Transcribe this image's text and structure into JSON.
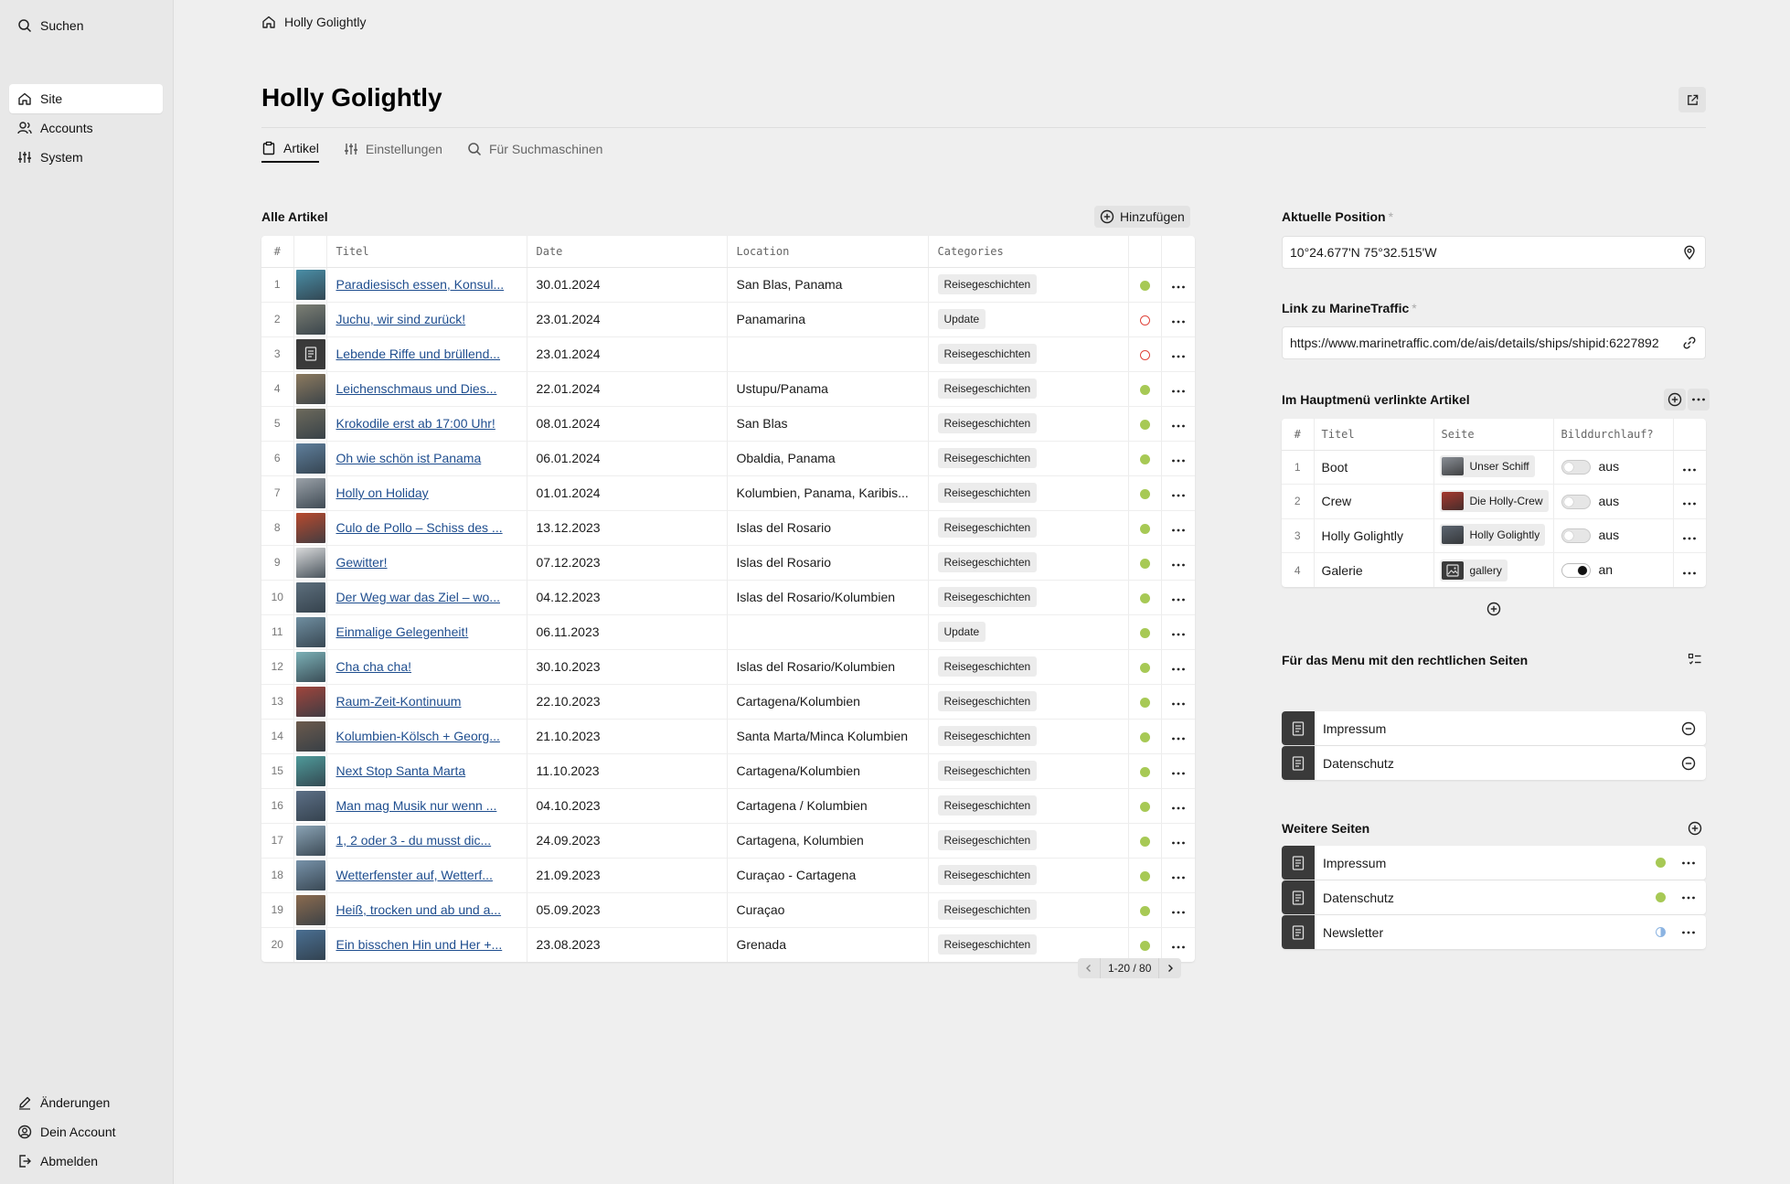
{
  "sidebar": {
    "search_label": "Suchen",
    "nav": [
      {
        "label": "Site",
        "active": true,
        "icon": "home-icon"
      },
      {
        "label": "Accounts",
        "active": false,
        "icon": "users-icon"
      },
      {
        "label": "System",
        "active": false,
        "icon": "sliders-icon"
      }
    ],
    "bottom": [
      {
        "label": "Änderungen",
        "icon": "pencil-icon"
      },
      {
        "label": "Dein Account",
        "icon": "account-icon"
      },
      {
        "label": "Abmelden",
        "icon": "logout-icon"
      }
    ]
  },
  "header": {
    "breadcrumb": "Holly Golightly",
    "title": "Holly Golightly",
    "tabs": [
      {
        "label": "Artikel",
        "active": true,
        "icon": "clipboard-icon"
      },
      {
        "label": "Einstellungen",
        "active": false,
        "icon": "sliders-icon"
      },
      {
        "label": "Für Suchmaschinen",
        "active": false,
        "icon": "search-icon"
      }
    ]
  },
  "articles": {
    "heading": "Alle Artikel",
    "add_label": "Hinzufügen",
    "columns": [
      "#",
      "",
      "Titel",
      "Date",
      "Location",
      "Categories"
    ],
    "rows": [
      {
        "n": "1",
        "title": "Paradiesisch essen, Konsul...",
        "date": "30.01.2024",
        "location": "San Blas, Panama",
        "category": "Reisegeschichten",
        "status": "listed",
        "thumb": "#4a8ea6"
      },
      {
        "n": "2",
        "title": "Juchu, wir sind zurück!",
        "date": "23.01.2024",
        "location": "Panamarina",
        "category": "Update",
        "status": "draft",
        "thumb": "#7c7f74"
      },
      {
        "n": "3",
        "title": "Lebende Riffe und brüllend...",
        "date": "23.01.2024",
        "location": "",
        "category": "Reisegeschichten",
        "status": "draft",
        "thumb": "doc"
      },
      {
        "n": "4",
        "title": "Leichenschmaus und Dies...",
        "date": "22.01.2024",
        "location": "Ustupu/Panama",
        "category": "Reisegeschichten",
        "status": "listed",
        "thumb": "#8c7a5f"
      },
      {
        "n": "5",
        "title": "Krokodile erst ab 17:00 Uhr!",
        "date": "08.01.2024",
        "location": "San Blas",
        "category": "Reisegeschichten",
        "status": "listed",
        "thumb": "#6d6a5c"
      },
      {
        "n": "6",
        "title": "Oh wie schön ist Panama",
        "date": "06.01.2024",
        "location": "Obaldia, Panama",
        "category": "Reisegeschichten",
        "status": "listed",
        "thumb": "#5f7f9c"
      },
      {
        "n": "7",
        "title": "Holly on Holiday",
        "date": "01.01.2024",
        "location": "Kolumbien, Panama, Karibis...",
        "category": "Reisegeschichten",
        "status": "listed",
        "thumb": "#9aa1a8"
      },
      {
        "n": "8",
        "title": "Culo de Pollo – Schiss des ...",
        "date": "13.12.2023",
        "location": "Islas del Rosario",
        "category": "Reisegeschichten",
        "status": "listed",
        "thumb": "#b84a2e"
      },
      {
        "n": "9",
        "title": "Gewitter!",
        "date": "07.12.2023",
        "location": "Islas del Rosario",
        "category": "Reisegeschichten",
        "status": "listed",
        "thumb": "#d9dadb"
      },
      {
        "n": "10",
        "title": "Der Weg war das Ziel – wo...",
        "date": "04.12.2023",
        "location": "Islas del Rosario/Kolumbien",
        "category": "Reisegeschichten",
        "status": "listed",
        "thumb": "#5d6f7d"
      },
      {
        "n": "11",
        "title": "Einmalige Gelegenheit!",
        "date": "06.11.2023",
        "location": "",
        "category": "Update",
        "status": "listed",
        "thumb": "#6f8ea0"
      },
      {
        "n": "12",
        "title": "Cha cha cha!",
        "date": "30.10.2023",
        "location": "Islas del Rosario/Kolumbien",
        "category": "Reisegeschichten",
        "status": "listed",
        "thumb": "#7bb0b6"
      },
      {
        "n": "13",
        "title": "Raum-Zeit-Kontinuum",
        "date": "22.10.2023",
        "location": "Cartagena/Kolumbien",
        "category": "Reisegeschichten",
        "status": "listed",
        "thumb": "#a0453c"
      },
      {
        "n": "14",
        "title": "Kolumbien-Kölsch + Georg...",
        "date": "21.10.2023",
        "location": "Santa Marta/Minca Kolumbien",
        "category": "Reisegeschichten",
        "status": "listed",
        "thumb": "#6b5a4d"
      },
      {
        "n": "15",
        "title": "Next Stop Santa Marta",
        "date": "11.10.2023",
        "location": "Cartagena/Kolumbien",
        "category": "Reisegeschichten",
        "status": "listed",
        "thumb": "#4f9a9a"
      },
      {
        "n": "16",
        "title": "Man mag Musik nur wenn ...",
        "date": "04.10.2023",
        "location": "Cartagena / Kolumbien",
        "category": "Reisegeschichten",
        "status": "listed",
        "thumb": "#5c6f86"
      },
      {
        "n": "17",
        "title": "1, 2 oder 3 - du musst dic...",
        "date": "24.09.2023",
        "location": "Cartagena, Kolumbien",
        "category": "Reisegeschichten",
        "status": "listed",
        "thumb": "#8aa3b5"
      },
      {
        "n": "18",
        "title": "Wetterfenster auf, Wetterf...",
        "date": "21.09.2023",
        "location": "Curaçao - Cartagena",
        "category": "Reisegeschichten",
        "status": "listed",
        "thumb": "#7792a9"
      },
      {
        "n": "19",
        "title": "Heiß, trocken und ab und a...",
        "date": "05.09.2023",
        "location": "Curaçao",
        "category": "Reisegeschichten",
        "status": "listed",
        "thumb": "#8b6b4f"
      },
      {
        "n": "20",
        "title": "Ein bisschen Hin und Her +...",
        "date": "23.08.2023",
        "location": "Grenada",
        "category": "Reisegeschichten",
        "status": "listed",
        "thumb": "#4a6f92"
      }
    ],
    "pagination": "1-20 / 80"
  },
  "position": {
    "label": "Aktuelle Position",
    "required_mark": "*",
    "value": "10°24.677'N  75°32.515'W"
  },
  "marinetraffic": {
    "label": "Link zu MarineTraffic",
    "required_mark": "*",
    "value": "https://www.marinetraffic.com/de/ais/details/ships/shipid:6227892"
  },
  "main_menu": {
    "heading": "Im Hauptmenü verlinkte Artikel",
    "columns": [
      "#",
      "Titel",
      "Seite",
      "Bilddurchlauf?"
    ],
    "rows": [
      {
        "n": "1",
        "title": "Boot",
        "page": "Unser Schiff",
        "toggle_on": false,
        "toggle_label": "aus",
        "thumb": "#8a8f96"
      },
      {
        "n": "2",
        "title": "Crew",
        "page": "Die Holly-Crew",
        "toggle_on": false,
        "toggle_label": "aus",
        "thumb": "#a6382f"
      },
      {
        "n": "3",
        "title": "Holly Golightly",
        "page": "Holly Golightly",
        "toggle_on": false,
        "toggle_label": "aus",
        "thumb": "#5c6570"
      },
      {
        "n": "4",
        "title": "Galerie",
        "page": "gallery",
        "toggle_on": true,
        "toggle_label": "an",
        "thumb": "image"
      }
    ]
  },
  "legal_menu": {
    "heading": "Für das Menu mit den rechtlichen Seiten",
    "items": [
      "Impressum",
      "Datenschutz"
    ]
  },
  "more_pages": {
    "heading": "Weitere Seiten",
    "items": [
      {
        "label": "Impressum",
        "status": "listed"
      },
      {
        "label": "Datenschutz",
        "status": "listed"
      },
      {
        "label": "Newsletter",
        "status": "unlisted"
      }
    ]
  },
  "colors": {
    "accent_link": "#1f4e8f",
    "status_listed": "#a7c955",
    "status_draft": "#e0443b",
    "status_unlisted": "#8cb4e2"
  }
}
